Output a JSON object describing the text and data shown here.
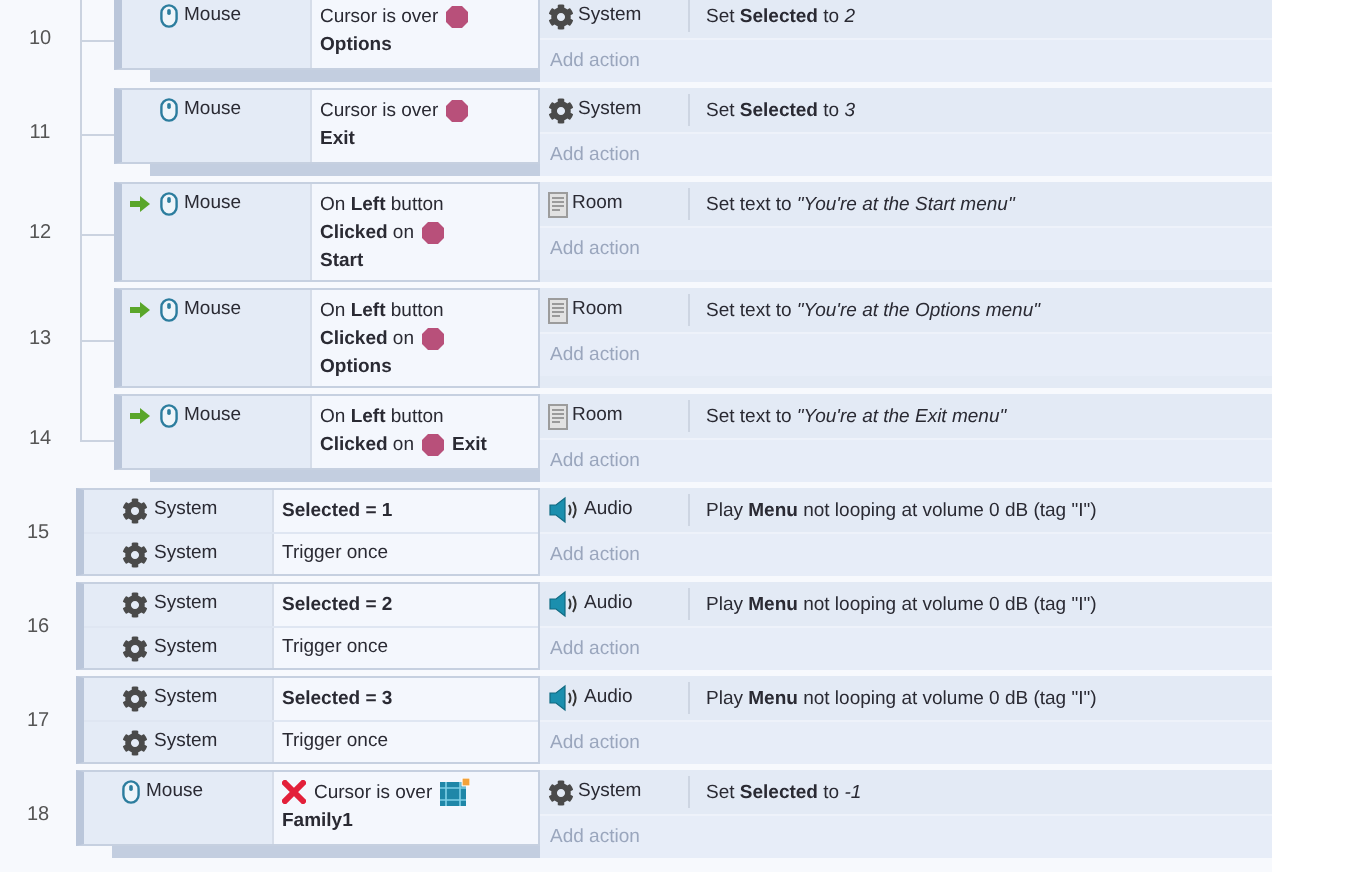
{
  "events": [
    {
      "number": "10",
      "sub": true,
      "bar": true,
      "conditions": [
        {
          "object": "Mouse",
          "kind": "mouse",
          "trigger": false,
          "inverted": false,
          "lines": [
            [
              {
                "kind": "text",
                "text": "Cursor is over"
              },
              {
                "kind": "sprite"
              }
            ],
            [
              {
                "kind": "text",
                "text": "**Options**"
              }
            ]
          ]
        }
      ],
      "actions": [
        {
          "object": "System",
          "kind": "system",
          "text": "Set **Selected** to *2*"
        }
      ],
      "add_action": "Add action"
    },
    {
      "number": "11",
      "sub": true,
      "bar": true,
      "conditions": [
        {
          "object": "Mouse",
          "kind": "mouse",
          "trigger": false,
          "inverted": false,
          "lines": [
            [
              {
                "kind": "text",
                "text": "Cursor is over"
              },
              {
                "kind": "sprite"
              }
            ],
            [
              {
                "kind": "text",
                "text": "**Exit**"
              }
            ]
          ]
        }
      ],
      "actions": [
        {
          "object": "System",
          "kind": "system",
          "text": "Set **Selected** to *3*"
        }
      ],
      "add_action": "Add action"
    },
    {
      "number": "12",
      "sub": true,
      "bar": false,
      "conditions": [
        {
          "object": "Mouse",
          "kind": "mouse",
          "trigger": true,
          "inverted": false,
          "lines": [
            [
              {
                "kind": "text",
                "text": "On **Left** button"
              }
            ],
            [
              {
                "kind": "text",
                "text": "**Clicked** on"
              },
              {
                "kind": "sprite"
              }
            ],
            [
              {
                "kind": "text",
                "text": "**Start**"
              }
            ]
          ]
        }
      ],
      "actions": [
        {
          "object": "Room",
          "kind": "room",
          "text": "Set text to *\"You're at the Start menu\"*"
        }
      ],
      "add_action": "Add action"
    },
    {
      "number": "13",
      "sub": true,
      "bar": false,
      "conditions": [
        {
          "object": "Mouse",
          "kind": "mouse",
          "trigger": true,
          "inverted": false,
          "lines": [
            [
              {
                "kind": "text",
                "text": "On **Left** button"
              }
            ],
            [
              {
                "kind": "text",
                "text": "**Clicked** on"
              },
              {
                "kind": "sprite"
              }
            ],
            [
              {
                "kind": "text",
                "text": "**Options**"
              }
            ]
          ]
        }
      ],
      "actions": [
        {
          "object": "Room",
          "kind": "room",
          "text": "Set text to *\"You're at the Options menu\"*"
        }
      ],
      "add_action": "Add action"
    },
    {
      "number": "14",
      "sub": true,
      "bar": true,
      "conditions": [
        {
          "object": "Mouse",
          "kind": "mouse",
          "trigger": true,
          "inverted": false,
          "lines": [
            [
              {
                "kind": "text",
                "text": "On **Left** button"
              }
            ],
            [
              {
                "kind": "text",
                "text": "**Clicked** on"
              },
              {
                "kind": "sprite"
              },
              {
                "kind": "text",
                "text": "**Exit**"
              }
            ]
          ]
        }
      ],
      "actions": [
        {
          "object": "Room",
          "kind": "room",
          "text": "Set text to *\"You're at the Exit menu\"*"
        }
      ],
      "add_action": "Add action"
    },
    {
      "number": "15",
      "sub": false,
      "bar": false,
      "conditions": [
        {
          "object": "System",
          "kind": "system",
          "trigger": false,
          "inverted": false,
          "lines": [
            [
              {
                "kind": "text",
                "text": "**Selected = 1**"
              }
            ]
          ]
        },
        {
          "object": "System",
          "kind": "system",
          "trigger": false,
          "inverted": false,
          "lines": [
            [
              {
                "kind": "text",
                "text": "Trigger once"
              }
            ]
          ]
        }
      ],
      "actions": [
        {
          "object": "Audio",
          "kind": "audio",
          "text": "Play **Menu** not looping at volume 0 dB (tag \"I\")"
        }
      ],
      "add_action": "Add action"
    },
    {
      "number": "16",
      "sub": false,
      "bar": false,
      "conditions": [
        {
          "object": "System",
          "kind": "system",
          "trigger": false,
          "inverted": false,
          "lines": [
            [
              {
                "kind": "text",
                "text": "**Selected = 2**"
              }
            ]
          ]
        },
        {
          "object": "System",
          "kind": "system",
          "trigger": false,
          "inverted": false,
          "lines": [
            [
              {
                "kind": "text",
                "text": "Trigger once"
              }
            ]
          ]
        }
      ],
      "actions": [
        {
          "object": "Audio",
          "kind": "audio",
          "text": "Play **Menu** not looping at volume 0 dB (tag \"I\")"
        }
      ],
      "add_action": "Add action"
    },
    {
      "number": "17",
      "sub": false,
      "bar": false,
      "conditions": [
        {
          "object": "System",
          "kind": "system",
          "trigger": false,
          "inverted": false,
          "lines": [
            [
              {
                "kind": "text",
                "text": "**Selected = 3**"
              }
            ]
          ]
        },
        {
          "object": "System",
          "kind": "system",
          "trigger": false,
          "inverted": false,
          "lines": [
            [
              {
                "kind": "text",
                "text": "Trigger once"
              }
            ]
          ]
        }
      ],
      "actions": [
        {
          "object": "Audio",
          "kind": "audio",
          "text": "Play **Menu** not looping at volume 0 dB (tag \"I\")"
        }
      ],
      "add_action": "Add action"
    },
    {
      "number": "18",
      "sub": false,
      "bar": true,
      "conditions": [
        {
          "object": "Mouse",
          "kind": "mouse",
          "trigger": false,
          "inverted": true,
          "lines": [
            [
              {
                "kind": "text",
                "text": "Cursor is over"
              },
              {
                "kind": "family"
              }
            ],
            [
              {
                "kind": "text",
                "text": "**Family1**"
              }
            ]
          ]
        }
      ],
      "actions": [
        {
          "object": "System",
          "kind": "system",
          "text": "Set **Selected** to *-1*"
        }
      ],
      "add_action": "Add action"
    }
  ]
}
